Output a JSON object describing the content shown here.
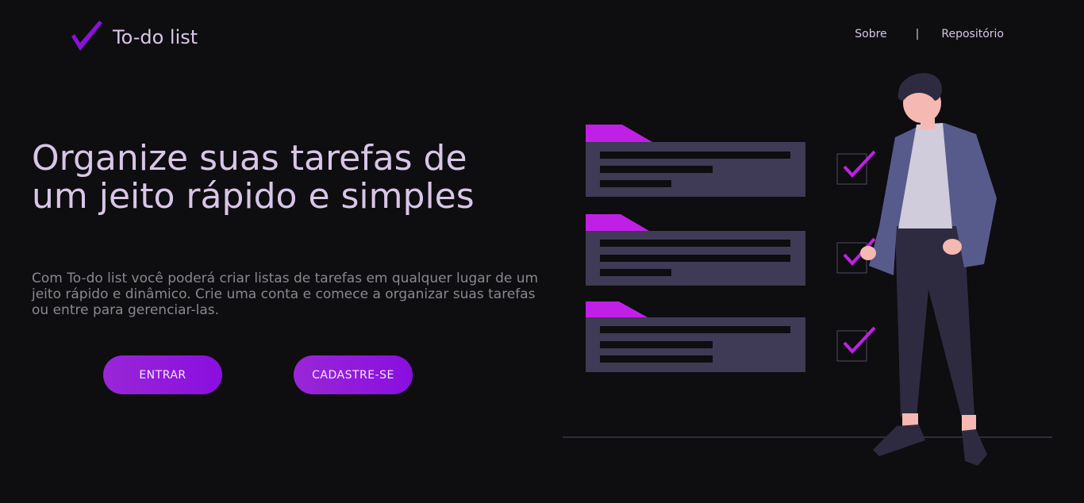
{
  "header": {
    "logo_icon": "checkmark-icon",
    "logo_text": "To-do list",
    "nav": {
      "about_label": "Sobre",
      "separator": "|",
      "repository_label": "Repositório"
    }
  },
  "hero": {
    "headline": "Organize suas tarefas de um jeito rápido e simples",
    "description": "Com To-do list você poderá criar listas de tarefas em qualquer lugar de um jeito rápido e dinâmico. Crie uma conta e comece a organizar suas tarefas ou entre para gerenciar-las.",
    "enter_button_label": "ENTRAR",
    "signup_button_label": "CADASTRE-SE"
  },
  "illustration": {
    "icon": "task-list-illustration",
    "accent_color": "#c020e6",
    "card_color": "#3f3a55"
  },
  "colors": {
    "background": "#0e0d0f",
    "text": "#d8c6e8",
    "muted_text": "#8a8790",
    "brand_purple": "#8a0ee0"
  }
}
